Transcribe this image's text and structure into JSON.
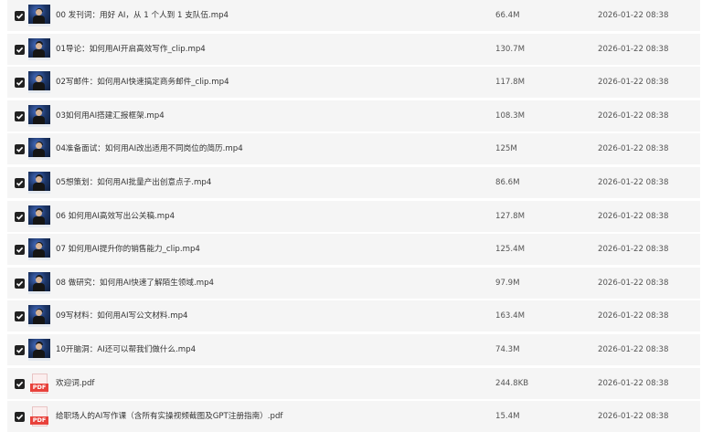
{
  "files": [
    {
      "name": "00 发刊词：用好 AI，从 1 个人到 1 支队伍.mp4",
      "size": "66.4M",
      "date": "2026-01-22 08:38",
      "type": "video",
      "checked": true
    },
    {
      "name": "01导论：如何用AI开启高效写作_clip.mp4",
      "size": "130.7M",
      "date": "2026-01-22 08:38",
      "type": "video",
      "checked": true
    },
    {
      "name": "02写邮件：如何用AI快速搞定商务邮件_clip.mp4",
      "size": "117.8M",
      "date": "2026-01-22 08:38",
      "type": "video",
      "checked": true
    },
    {
      "name": "03如何用AI搭建汇报框架.mp4",
      "size": "108.3M",
      "date": "2026-01-22 08:38",
      "type": "video",
      "checked": true
    },
    {
      "name": "04准备面试：如何用AI改出适用不同岗位的简历.mp4",
      "size": "125M",
      "date": "2026-01-22 08:38",
      "type": "video",
      "checked": true
    },
    {
      "name": "05想策划：如何用AI批量产出创意点子.mp4",
      "size": "86.6M",
      "date": "2026-01-22 08:38",
      "type": "video",
      "checked": true
    },
    {
      "name": "06 如何用AI高效写出公关稿.mp4",
      "size": "127.8M",
      "date": "2026-01-22 08:38",
      "type": "video",
      "checked": true
    },
    {
      "name": "07 如何用AI提升你的销售能力_clip.mp4",
      "size": "125.4M",
      "date": "2026-01-22 08:38",
      "type": "video",
      "checked": true
    },
    {
      "name": "08 做研究：如何用AI快速了解陌生领域.mp4",
      "size": "97.9M",
      "date": "2026-01-22 08:38",
      "type": "video",
      "checked": true
    },
    {
      "name": "09写材料：如何用AI写公文材料.mp4",
      "size": "163.4M",
      "date": "2026-01-22 08:38",
      "type": "video",
      "checked": true
    },
    {
      "name": "10开脑洞：AI还可以帮我们做什么.mp4",
      "size": "74.3M",
      "date": "2026-01-22 08:38",
      "type": "video",
      "checked": true
    },
    {
      "name": "欢迎词.pdf",
      "size": "244.8KB",
      "date": "2026-01-22 08:38",
      "type": "pdf",
      "checked": true
    },
    {
      "name": "给职场人的AI写作课（含所有实操视频截图及GPT注册指南）.pdf",
      "size": "15.4M",
      "date": "2026-01-22 08:38",
      "type": "pdf",
      "checked": true
    }
  ],
  "icons": {
    "checkbox": "checkbox-checked-icon",
    "video": "video-thumbnail-icon",
    "pdf": "pdf-file-icon",
    "pdf_label": "PDF"
  },
  "colors": {
    "row_bg": "#f5f5f5",
    "checkbox": "#222222",
    "pdf_red": "#e8413b"
  }
}
